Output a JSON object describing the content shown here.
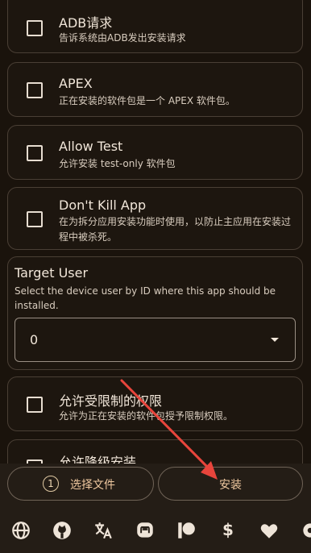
{
  "options": [
    {
      "title": "ADB请求",
      "desc": "告诉系统由ADB发出安装请求",
      "checked": false
    },
    {
      "title": "APEX",
      "desc": "正在安装的软件包是一个 APEX 软件包。",
      "checked": false
    },
    {
      "title": "Allow Test",
      "desc": "允许安装 test-only 软件包",
      "checked": false
    },
    {
      "title": "Don't Kill App",
      "desc": "在为拆分应用安装功能时使用，以防止主应用在安装过程中被杀死。",
      "checked": false
    },
    {
      "title": "允许受限制的权限",
      "desc": "允许为正在安装的软件包授予限制权限。",
      "checked": false
    },
    {
      "title": "允许降级安装",
      "desc": "",
      "checked": false
    }
  ],
  "target_user": {
    "title": "Target User",
    "desc": "Select the device user by ID where this app should be installed.",
    "value": "0"
  },
  "bottom": {
    "select_badge": "1",
    "select_label": "选择文件",
    "install_label": "安装"
  },
  "icons": [
    "globe-icon",
    "github-icon",
    "translate-icon",
    "mastodon-icon",
    "patreon-icon",
    "dollar-icon",
    "heart-icon",
    "settings-icon"
  ],
  "colors": {
    "background": "#1a130c",
    "accent": "#f0c9a0",
    "annotation_arrow": "#e8453c"
  }
}
